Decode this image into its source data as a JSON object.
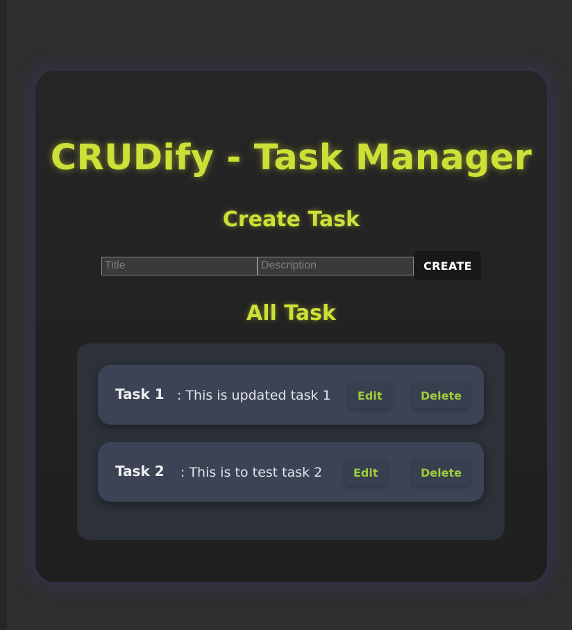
{
  "app": {
    "title": "CRUDify - Task Manager"
  },
  "create": {
    "heading": "Create Task",
    "title_placeholder": "Title",
    "title_value": "",
    "description_placeholder": "Description",
    "description_value": "",
    "button_label": "CREATE"
  },
  "tasks": {
    "heading": "All Task",
    "items": [
      {
        "title": "Task 1",
        "description": ": This is updated task 1",
        "edit_label": "Edit",
        "delete_label": "Delete"
      },
      {
        "title": "Task 2",
        "description": ": This is to test task 2",
        "edit_label": "Edit",
        "delete_label": "Delete"
      }
    ]
  },
  "colors": {
    "accent": "#cde037",
    "button_text": "#9ccc3c",
    "page_background": "#2f2f2f",
    "card_background": "#222222",
    "panel_background": "#2c313a",
    "task_background": "#3b4355"
  }
}
